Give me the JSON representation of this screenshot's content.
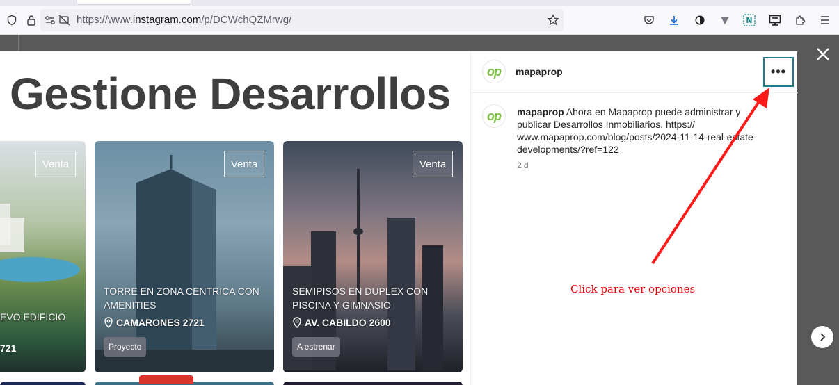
{
  "browser": {
    "url_prefix": "https://www.",
    "url_domain": "instagram.com",
    "url_path": "/p/DCWchQZMrwg/"
  },
  "post": {
    "headline": "Gestione Desarrollos",
    "cards": [
      {
        "badge": "Venta",
        "title": "EVO EDIFICIO",
        "address": "721",
        "tag": ""
      },
      {
        "badge": "Venta",
        "title": "TORRE EN ZONA CENTRICA CON AMENITIES",
        "address": "CAMARONES 2721",
        "tag": "Proyecto"
      },
      {
        "badge": "Venta",
        "title": "SEMIPISOS EN DUPLEX CON PISCINA Y GIMNASIO",
        "address": "AV. CABILDO 2600",
        "tag": "A estrenar"
      }
    ]
  },
  "side": {
    "avatar_text": "op",
    "username": "mapaprop",
    "more_label": "•••",
    "caption_user": "mapaprop",
    "caption_text": " Ahora en Mapaprop puede administrar y publicar Desarrollos Inmobiliarios. https:// www.mapaprop.com/blog/posts/2024-11-14-real-estate-developments/?ref=122",
    "time_ago": "2 d"
  },
  "annotation": {
    "text": "Click para ver opciones",
    "color": "#e60000"
  },
  "colors": {
    "highlight_border": "#1f7a8c",
    "brand_green": "#7bc043"
  }
}
